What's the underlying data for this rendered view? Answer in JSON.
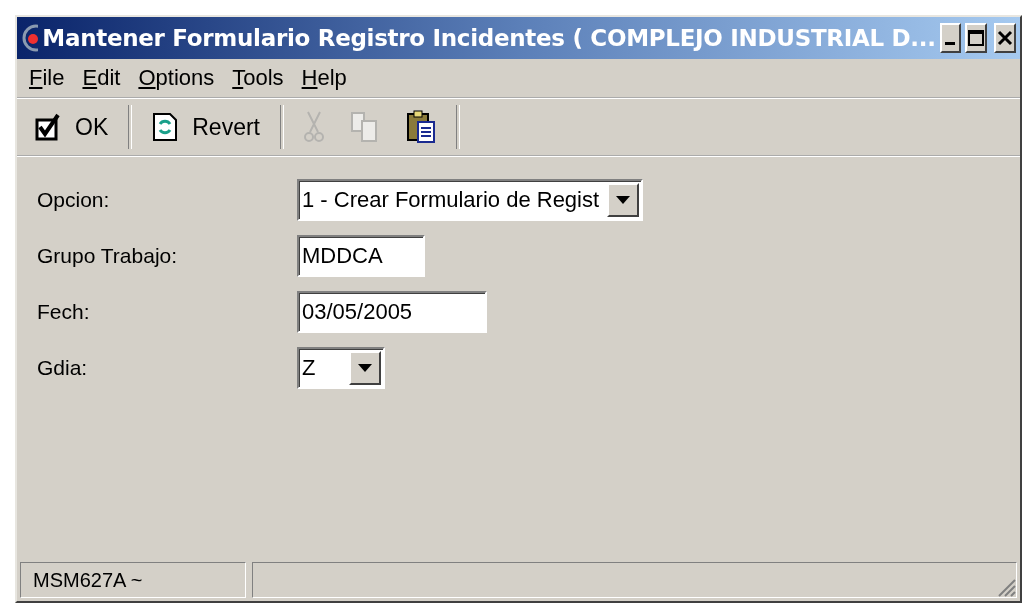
{
  "window": {
    "title": "Mantener Formulario Registro Incidentes ( COMPLEJO INDUSTRIAL D..."
  },
  "menu": [
    {
      "label": "File"
    },
    {
      "label": "Edit"
    },
    {
      "label": "Options"
    },
    {
      "label": "Tools"
    },
    {
      "label": "Help"
    }
  ],
  "toolbar": [
    {
      "kind": "ok",
      "label": "OK",
      "disabled": false
    },
    {
      "kind": "revert",
      "label": "Revert",
      "disabled": false
    },
    {
      "kind": "cut",
      "disabled": true
    },
    {
      "kind": "copy",
      "disabled": true
    },
    {
      "kind": "paste",
      "disabled": false
    }
  ],
  "form": [
    {
      "kind": "combo",
      "label": "Opcion:",
      "value": "1 - Crear Formulario de Regist"
    },
    {
      "kind": "text",
      "label": "Grupo Trabajo:",
      "value": "MDDCA"
    },
    {
      "kind": "text",
      "label": "Fech:",
      "value": "03/05/2005"
    },
    {
      "kind": "combo",
      "label": "Gdia:",
      "value": "Z"
    }
  ],
  "status_bar": {
    "panels": [
      "MSM627A ~"
    ]
  }
}
